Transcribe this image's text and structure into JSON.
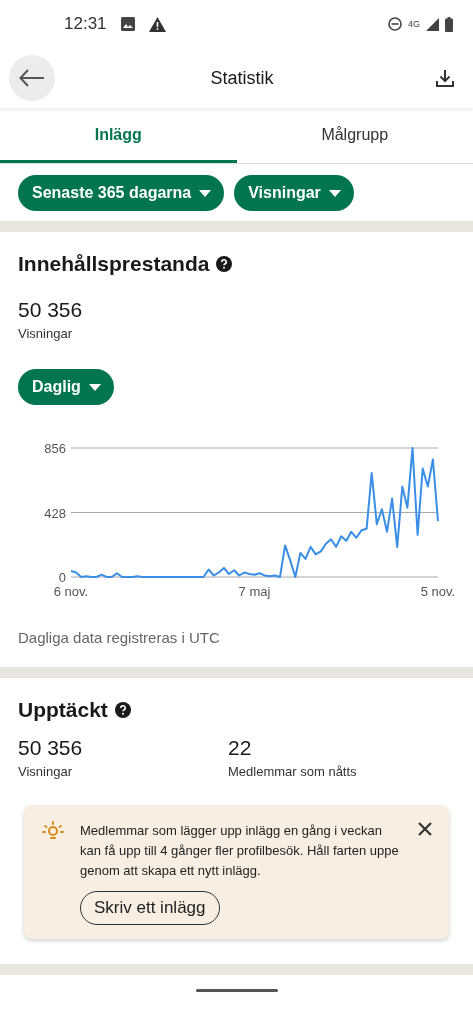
{
  "status_bar": {
    "time": "12:31",
    "network": "4G"
  },
  "header": {
    "title": "Statistik"
  },
  "tabs": [
    {
      "label": "Inlägg",
      "selected": true
    },
    {
      "label": "Målgrupp",
      "selected": false
    }
  ],
  "filters": [
    {
      "label": "Senaste 365 dagarna"
    },
    {
      "label": "Visningar"
    }
  ],
  "performance": {
    "title": "Innehållsprestanda",
    "value": "50 356",
    "value_label": "Visningar",
    "interval": "Daglig",
    "chart_data": {
      "type": "line",
      "ylim": [
        0,
        856
      ],
      "yticks": [
        0,
        428,
        856
      ],
      "categories": [
        "6 nov.",
        null,
        null,
        null,
        null,
        null,
        null,
        null,
        null,
        null,
        null,
        null,
        null,
        null,
        null,
        null,
        null,
        null,
        null,
        null,
        null,
        null,
        null,
        null,
        null,
        null,
        null,
        null,
        null,
        null,
        null,
        null,
        null,
        null,
        null,
        null,
        "7 maj",
        null,
        null,
        null,
        null,
        null,
        null,
        null,
        null,
        null,
        null,
        null,
        null,
        null,
        null,
        null,
        null,
        null,
        null,
        null,
        null,
        null,
        null,
        null,
        null,
        null,
        null,
        null,
        null,
        null,
        null,
        null,
        null,
        null,
        null,
        null,
        "5 nov."
      ],
      "series": [
        {
          "color": "#3a8ee6",
          "values": [
            40,
            30,
            0,
            5,
            0,
            0,
            15,
            0,
            0,
            25,
            0,
            0,
            0,
            5,
            0,
            0,
            0,
            0,
            0,
            0,
            0,
            0,
            0,
            0,
            0,
            0,
            0,
            50,
            10,
            30,
            60,
            20,
            45,
            10,
            30,
            20,
            15,
            25,
            10,
            5,
            10,
            0,
            210,
            110,
            0,
            160,
            120,
            200,
            150,
            170,
            220,
            250,
            200,
            270,
            240,
            300,
            260,
            310,
            320,
            690,
            350,
            450,
            300,
            520,
            200,
            600,
            460,
            856,
            280,
            720,
            600,
            780,
            370
          ]
        }
      ]
    },
    "note": "Dagliga data registreras i UTC"
  },
  "discovery": {
    "title": "Upptäckt",
    "stats": [
      {
        "value": "50 356",
        "label": "Visningar"
      },
      {
        "value": "22",
        "label": "Medlemmar som nåtts"
      }
    ],
    "tip": {
      "text": "Medlemmar som lägger upp inlägg en gång i veckan kan få upp till 4 gånger fler profilbesök. Håll farten uppe genom att skapa ett nytt inlägg.",
      "button": "Skriv ett inlägg"
    }
  }
}
